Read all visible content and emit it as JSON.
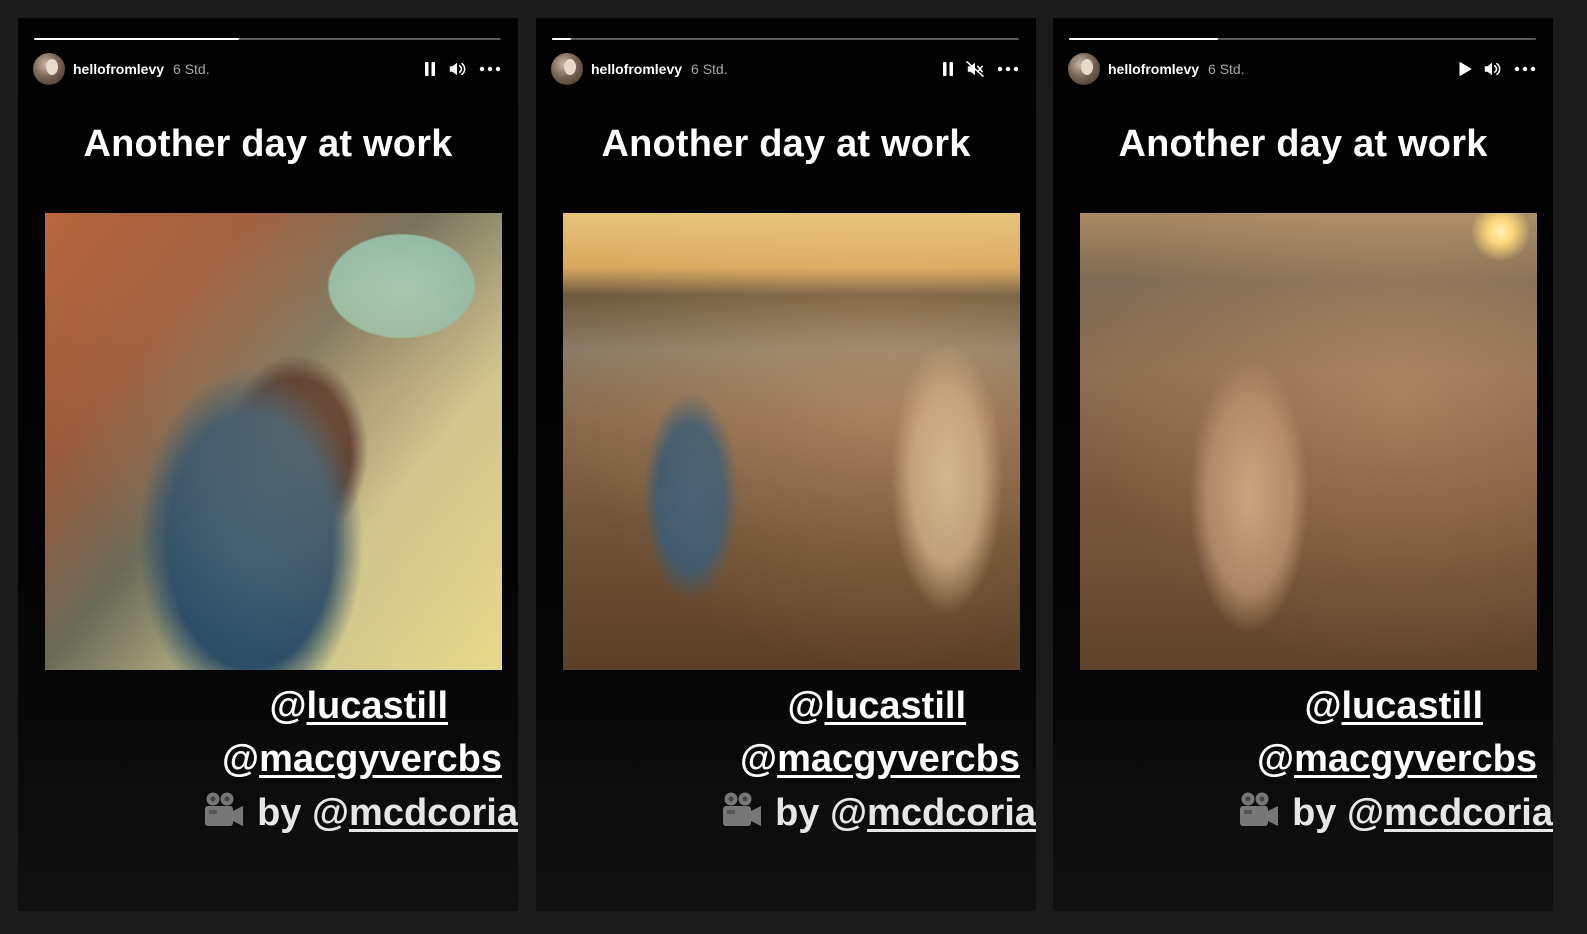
{
  "stories": [
    {
      "progress": 0.44,
      "username": "hellofromlevy",
      "time": "6 Std.",
      "play_state": "pause",
      "sound_state": "sound-on",
      "title": "Another day at work",
      "mentions": {
        "first": {
          "at": "@",
          "handle": "lucastill"
        },
        "second": {
          "at": "@",
          "handle": "macgyvercbs"
        },
        "credit": {
          "icon": "camera-icon",
          "by": "by @",
          "handle": "mcdcoria"
        }
      }
    },
    {
      "progress": 0.04,
      "username": "hellofromlevy",
      "time": "6 Std.",
      "play_state": "pause",
      "sound_state": "muted",
      "title": "Another day at work",
      "mentions": {
        "first": {
          "at": "@",
          "handle": "lucastill"
        },
        "second": {
          "at": "@",
          "handle": "macgyvercbs"
        },
        "credit": {
          "icon": "camera-icon",
          "by": "by @",
          "handle": "mcdcoria"
        }
      }
    },
    {
      "progress": 0.32,
      "username": "hellofromlevy",
      "time": "6 Std.",
      "play_state": "play",
      "sound_state": "sound-on",
      "title": "Another day at work",
      "mentions": {
        "first": {
          "at": "@",
          "handle": "lucastill"
        },
        "second": {
          "at": "@",
          "handle": "macgyvercbs"
        },
        "credit": {
          "icon": "camera-icon",
          "by": "by @",
          "handle": "mcdcoria"
        }
      }
    }
  ],
  "colors": {
    "background": "#1b1b1c",
    "story_background": "#000000",
    "text": "#ffffff",
    "muted_text": "#a8a8a8"
  }
}
